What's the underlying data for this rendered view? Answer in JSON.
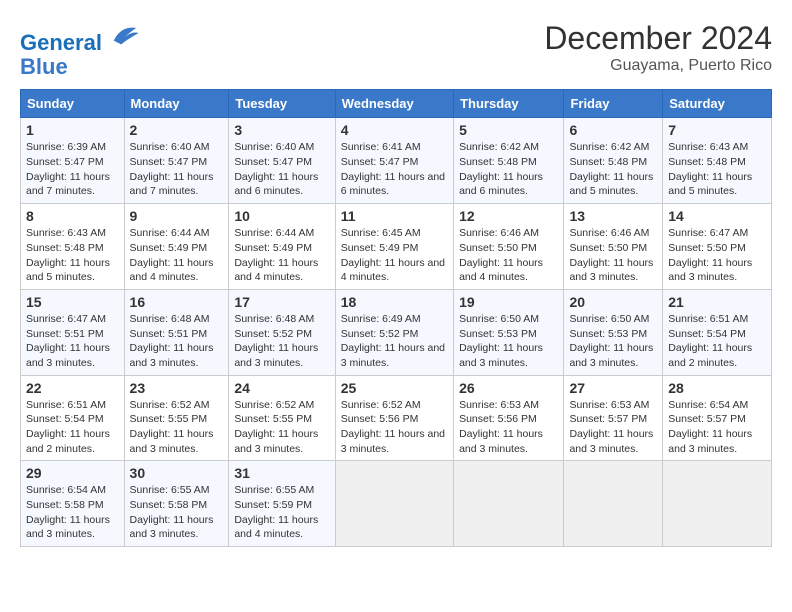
{
  "header": {
    "logo_line1": "General",
    "logo_line2": "Blue",
    "month_year": "December 2024",
    "location": "Guayama, Puerto Rico"
  },
  "weekdays": [
    "Sunday",
    "Monday",
    "Tuesday",
    "Wednesday",
    "Thursday",
    "Friday",
    "Saturday"
  ],
  "weeks": [
    [
      {
        "day": 1,
        "sunrise": "6:39 AM",
        "sunset": "5:47 PM",
        "daylight": "11 hours and 7 minutes."
      },
      {
        "day": 2,
        "sunrise": "6:40 AM",
        "sunset": "5:47 PM",
        "daylight": "11 hours and 7 minutes."
      },
      {
        "day": 3,
        "sunrise": "6:40 AM",
        "sunset": "5:47 PM",
        "daylight": "11 hours and 6 minutes."
      },
      {
        "day": 4,
        "sunrise": "6:41 AM",
        "sunset": "5:47 PM",
        "daylight": "11 hours and 6 minutes."
      },
      {
        "day": 5,
        "sunrise": "6:42 AM",
        "sunset": "5:48 PM",
        "daylight": "11 hours and 6 minutes."
      },
      {
        "day": 6,
        "sunrise": "6:42 AM",
        "sunset": "5:48 PM",
        "daylight": "11 hours and 5 minutes."
      },
      {
        "day": 7,
        "sunrise": "6:43 AM",
        "sunset": "5:48 PM",
        "daylight": "11 hours and 5 minutes."
      }
    ],
    [
      {
        "day": 8,
        "sunrise": "6:43 AM",
        "sunset": "5:48 PM",
        "daylight": "11 hours and 5 minutes."
      },
      {
        "day": 9,
        "sunrise": "6:44 AM",
        "sunset": "5:49 PM",
        "daylight": "11 hours and 4 minutes."
      },
      {
        "day": 10,
        "sunrise": "6:44 AM",
        "sunset": "5:49 PM",
        "daylight": "11 hours and 4 minutes."
      },
      {
        "day": 11,
        "sunrise": "6:45 AM",
        "sunset": "5:49 PM",
        "daylight": "11 hours and 4 minutes."
      },
      {
        "day": 12,
        "sunrise": "6:46 AM",
        "sunset": "5:50 PM",
        "daylight": "11 hours and 4 minutes."
      },
      {
        "day": 13,
        "sunrise": "6:46 AM",
        "sunset": "5:50 PM",
        "daylight": "11 hours and 3 minutes."
      },
      {
        "day": 14,
        "sunrise": "6:47 AM",
        "sunset": "5:50 PM",
        "daylight": "11 hours and 3 minutes."
      }
    ],
    [
      {
        "day": 15,
        "sunrise": "6:47 AM",
        "sunset": "5:51 PM",
        "daylight": "11 hours and 3 minutes."
      },
      {
        "day": 16,
        "sunrise": "6:48 AM",
        "sunset": "5:51 PM",
        "daylight": "11 hours and 3 minutes."
      },
      {
        "day": 17,
        "sunrise": "6:48 AM",
        "sunset": "5:52 PM",
        "daylight": "11 hours and 3 minutes."
      },
      {
        "day": 18,
        "sunrise": "6:49 AM",
        "sunset": "5:52 PM",
        "daylight": "11 hours and 3 minutes."
      },
      {
        "day": 19,
        "sunrise": "6:50 AM",
        "sunset": "5:53 PM",
        "daylight": "11 hours and 3 minutes."
      },
      {
        "day": 20,
        "sunrise": "6:50 AM",
        "sunset": "5:53 PM",
        "daylight": "11 hours and 3 minutes."
      },
      {
        "day": 21,
        "sunrise": "6:51 AM",
        "sunset": "5:54 PM",
        "daylight": "11 hours and 2 minutes."
      }
    ],
    [
      {
        "day": 22,
        "sunrise": "6:51 AM",
        "sunset": "5:54 PM",
        "daylight": "11 hours and 2 minutes."
      },
      {
        "day": 23,
        "sunrise": "6:52 AM",
        "sunset": "5:55 PM",
        "daylight": "11 hours and 3 minutes."
      },
      {
        "day": 24,
        "sunrise": "6:52 AM",
        "sunset": "5:55 PM",
        "daylight": "11 hours and 3 minutes."
      },
      {
        "day": 25,
        "sunrise": "6:52 AM",
        "sunset": "5:56 PM",
        "daylight": "11 hours and 3 minutes."
      },
      {
        "day": 26,
        "sunrise": "6:53 AM",
        "sunset": "5:56 PM",
        "daylight": "11 hours and 3 minutes."
      },
      {
        "day": 27,
        "sunrise": "6:53 AM",
        "sunset": "5:57 PM",
        "daylight": "11 hours and 3 minutes."
      },
      {
        "day": 28,
        "sunrise": "6:54 AM",
        "sunset": "5:57 PM",
        "daylight": "11 hours and 3 minutes."
      }
    ],
    [
      {
        "day": 29,
        "sunrise": "6:54 AM",
        "sunset": "5:58 PM",
        "daylight": "11 hours and 3 minutes."
      },
      {
        "day": 30,
        "sunrise": "6:55 AM",
        "sunset": "5:58 PM",
        "daylight": "11 hours and 3 minutes."
      },
      {
        "day": 31,
        "sunrise": "6:55 AM",
        "sunset": "5:59 PM",
        "daylight": "11 hours and 4 minutes."
      },
      null,
      null,
      null,
      null
    ]
  ]
}
